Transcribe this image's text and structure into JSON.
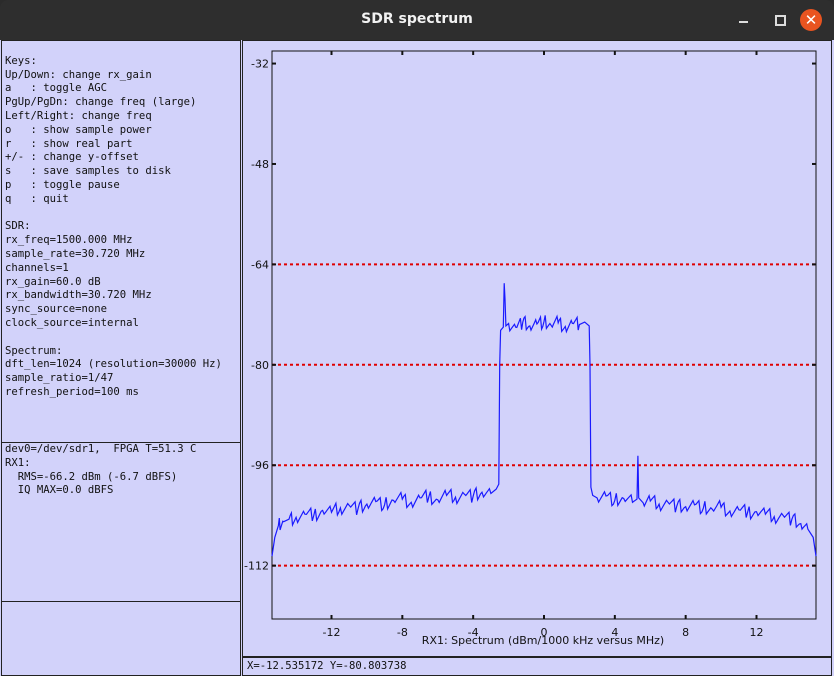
{
  "window": {
    "title": "SDR spectrum",
    "minimize_icon": "minimize-icon",
    "maximize_icon": "maximize-icon",
    "close_icon": "close-icon",
    "close_symbol": "✕"
  },
  "info_panel": {
    "lines": [
      "",
      "Keys:",
      "Up/Down: change rx_gain",
      "a   : toggle AGC",
      "PgUp/PgDn: change freq (large)",
      "Left/Right: change freq",
      "o   : show sample power",
      "r   : show real part",
      "+/- : change y-offset",
      "s   : save samples to disk",
      "p   : toggle pause",
      "q   : quit",
      "",
      "SDR:",
      "rx_freq=1500.000 MHz",
      "sample_rate=30.720 MHz",
      "channels=1",
      "rx_gain=60.0 dB",
      "rx_bandwidth=30.720 MHz",
      "sync_source=none",
      "clock_source=internal",
      "",
      "Spectrum:",
      "dft_len=1024 (resolution=30000 Hz)",
      "sample_ratio=1/47",
      "refresh_period=100 ms"
    ]
  },
  "status_panel": {
    "lines": [
      "dev0=/dev/sdr1,  FPGA T=51.3 C",
      "RX1:",
      "  RMS=-66.2 dBm (-6.7 dBFS)",
      "  IQ MAX=0.0 dBFS"
    ]
  },
  "status_bar": {
    "text": "X=-12.535172 Y=-80.803738"
  },
  "chart_data": {
    "type": "line",
    "xlabel": "RX1: Spectrum (dBm/1000 kHz versus MHz)",
    "ylabel": "",
    "xlim": [
      -15.36,
      15.36
    ],
    "ylim": [
      -120.5,
      -30
    ],
    "xticks": [
      -12,
      -8,
      -4,
      0,
      4,
      8,
      12
    ],
    "yticks": [
      -32,
      -48,
      -64,
      -80,
      -96,
      -112
    ],
    "reference_lines": [
      -64,
      -80,
      -96,
      -112
    ],
    "grid": false,
    "colors": {
      "series": "#1a1aff",
      "reference": "#e00000",
      "background": "#d2d2fa"
    },
    "series": [
      {
        "x": [
          -15.36,
          -15.2,
          -15.0,
          -14.7,
          -14.4,
          -14.0,
          -13.5,
          -13.0,
          -12.5,
          -12.0,
          -11.5,
          -11.0,
          -10.5,
          -10.0,
          -9.5,
          -9.0,
          -8.5,
          -8.0,
          -7.5,
          -7.0,
          -6.5,
          -6.0,
          -5.5,
          -5.0,
          -4.5,
          -4.0,
          -3.5,
          -3.0,
          -2.7,
          -2.55,
          -2.5,
          -2.45,
          -2.3,
          -2.25,
          -2.2,
          -2.15,
          -2.0,
          -1.6,
          -1.2,
          -0.8,
          -0.4,
          0.0,
          0.4,
          0.8,
          1.2,
          1.6,
          2.0,
          2.3,
          2.55,
          2.6,
          2.65,
          2.75,
          3.0,
          3.5,
          4.0,
          4.5,
          5.0,
          5.25,
          5.3,
          5.35,
          5.6,
          6.0,
          6.5,
          7.0,
          7.5,
          8.0,
          8.5,
          9.0,
          9.5,
          10.0,
          10.5,
          11.0,
          11.5,
          12.0,
          12.5,
          13.0,
          13.5,
          14.0,
          14.5,
          14.9,
          15.2,
          15.36
        ],
        "y": [
          -110.5,
          -107.5,
          -105.6,
          -105.0,
          -104.6,
          -104.3,
          -103.8,
          -104.0,
          -103.2,
          -103.5,
          -102.8,
          -102.4,
          -102.9,
          -102.2,
          -101.8,
          -102.3,
          -101.6,
          -101.4,
          -101.9,
          -101.2,
          -101.0,
          -101.5,
          -100.8,
          -101.1,
          -100.6,
          -100.9,
          -100.3,
          -100.5,
          -99.8,
          -99.0,
          -80.0,
          -74.5,
          -74.0,
          -67.0,
          -69.5,
          -73.8,
          -73.4,
          -74.0,
          -73.2,
          -73.8,
          -73.5,
          -73.1,
          -73.7,
          -73.3,
          -73.9,
          -73.4,
          -73.6,
          -73.2,
          -73.8,
          -80.0,
          -99.5,
          -100.8,
          -101.2,
          -100.9,
          -101.6,
          -101.3,
          -101.9,
          -101.4,
          -94.5,
          -101.2,
          -102.0,
          -101.7,
          -102.2,
          -101.9,
          -102.5,
          -102.6,
          -102.3,
          -102.8,
          -103.0,
          -102.7,
          -103.3,
          -103.1,
          -103.5,
          -103.4,
          -103.8,
          -104.2,
          -104.0,
          -104.6,
          -105.3,
          -106.2,
          -107.5,
          -110.5
        ]
      }
    ]
  }
}
